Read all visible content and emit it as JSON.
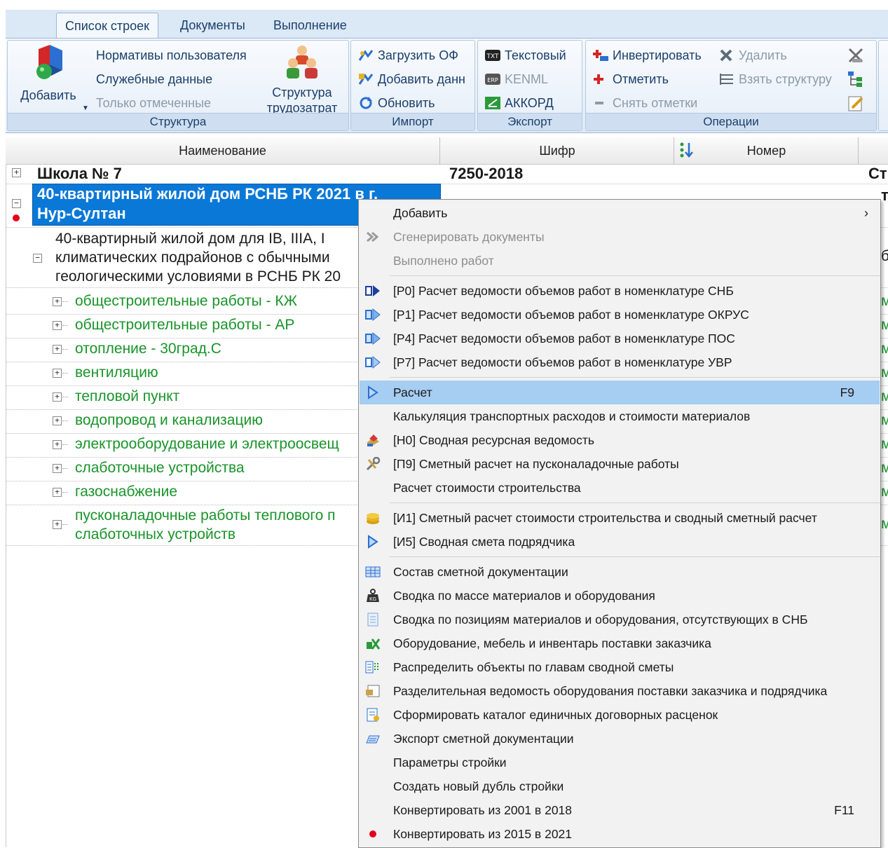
{
  "tabs": [
    "Список строек",
    "Документы",
    "Выполнение"
  ],
  "ribbon": {
    "structure": {
      "label": "Структура",
      "add": "Добавить",
      "user_norms": "Нормативы пользователя",
      "service_data": "Служебные данные",
      "only_marked": "Только отмеченные",
      "labor_structure_1": "Структура",
      "labor_structure_2": "трудозатрат"
    },
    "import": {
      "label": "Импорт",
      "load_of": "Загрузить ОФ",
      "add_data": "Добавить данн",
      "refresh": "Обновить"
    },
    "export": {
      "label": "Экспорт",
      "text": "Текстовый",
      "kenml": "KENML",
      "akkord": "АККОРД"
    },
    "operations": {
      "label": "Операции",
      "invert": "Инвертировать",
      "mark": "Отметить",
      "unmark": "Снять отметки",
      "delete": "Удалить",
      "take_structure": "Взять структуру"
    }
  },
  "grid": {
    "columns": [
      "Наименование",
      "Шифр",
      "Номер"
    ],
    "rows": {
      "school": "Школа № 7",
      "school_code": "7250-2018",
      "school_col3": "Ст",
      "house_1": "40-квартирный жилой дом РСНБ РК 2021 в г.",
      "house_2": "Нур-Султан",
      "house_col3": "т",
      "desc_1": "40-квартирный жилой дом для IB, IIIA, I",
      "desc_2": "климатических подрайонов с обычными",
      "desc_3": "геологическими условиями в РСНБ РК 20",
      "desc_col3": "б",
      "children": [
        "общестроительные работы - КЖ",
        "общестроительные работы - АР",
        "отопление - 30град.С",
        "вентиляцию",
        "тепловой пункт",
        "водопровод и канализацию",
        "электрооборудование и электроосвещ",
        "слаботочные устройства",
        "газоснабжение"
      ],
      "child_col3": "м",
      "last_1": "пусконаладочные работы теплового п",
      "last_2": "слаботочных устройств"
    }
  },
  "menu": {
    "add": "Добавить",
    "generate": "Сгенерировать документы",
    "done": "Выполнено работ",
    "p0": "[Р0] Расчет ведомости объемов работ в номенклатуре СНБ",
    "p1": "[Р1] Расчет ведомости объемов работ в номенклатуре ОКРУС",
    "p4": "[Р4] Расчет ведомости объемов работ в номенклатуре ПОС",
    "p7": "[Р7] Расчет ведомости объемов работ в номенклатуре УВР",
    "calc": "Расчет",
    "calc_sc": "F9",
    "transport": "Калькуляция транспортных расходов и стоимости материалов",
    "h0": "[Н0] Сводная ресурсная ведомость",
    "p9": "[П9] Сметный расчет на пусконаладочные работы",
    "build_cost": "Расчет стоимости строительства",
    "i1": "[И1] Сметный расчет стоимости строительства и сводный сметный расчет",
    "i5": "[И5] Сводная смета подрядчика",
    "composition": "Состав сметной документации",
    "mass": "Сводка по массе материалов и оборудования",
    "missing": "Сводка по позициям материалов и оборудования, отсутствующих в СНБ",
    "equipment": "Оборудование, мебель и инвентарь поставки заказчика",
    "distribute": "Распределить объекты по главам сводной сметы",
    "separate": "Разделительная ведомость оборудования поставки заказчика и подрядчика",
    "catalog": "Сформировать каталог единичных договорных расценок",
    "export_docs": "Экспорт сметной документации",
    "params": "Параметры стройки",
    "duplicate": "Создать новый дубль стройки",
    "conv2001": "Конвертировать из 2001 в 2018",
    "conv2001_sc": "F11",
    "conv2015": "Конвертировать из 2015 в 2021"
  }
}
